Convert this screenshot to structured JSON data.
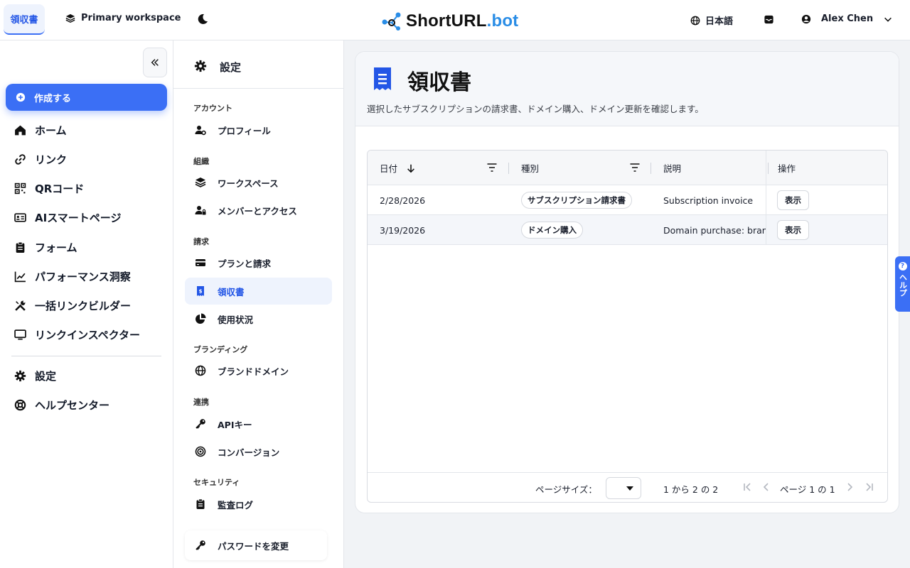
{
  "topbar": {
    "active_tab": "領収書",
    "workspace": "Primary workspace",
    "logo_main": "ShortURL",
    "logo_tld": ".bot",
    "language": "日本語",
    "user_name": "Alex Chen"
  },
  "sidebar": {
    "create_label": "作成する",
    "items": [
      {
        "label": "ホーム",
        "icon": "home-icon"
      },
      {
        "label": "リンク",
        "icon": "link-icon"
      },
      {
        "label": "QRコード",
        "icon": "qr-icon"
      },
      {
        "label": "AIスマートページ",
        "icon": "id-card-icon"
      },
      {
        "label": "フォーム",
        "icon": "clipboard-icon"
      },
      {
        "label": "パフォーマンス洞察",
        "icon": "chart-icon"
      },
      {
        "label": "一括リンクビルダー",
        "icon": "tools-icon"
      },
      {
        "label": "リンクインスペクター",
        "icon": "monitor-icon"
      }
    ],
    "bottom_items": [
      {
        "label": "設定",
        "icon": "gear-icon"
      },
      {
        "label": "ヘルプセンター",
        "icon": "lifebuoy-icon"
      }
    ]
  },
  "settings": {
    "title": "設定",
    "sections": {
      "account": "アカウント",
      "org": "組織",
      "billing": "請求",
      "branding": "ブランディング",
      "integration": "連携",
      "security": "セキュリティ"
    },
    "items": {
      "profile": "プロフィール",
      "workspace": "ワークスペース",
      "members": "メンバーとアクセス",
      "plans": "プランと請求",
      "receipts": "領収書",
      "usage": "使用状況",
      "brand_domains": "ブランドドメイン",
      "api_keys": "APIキー",
      "conversion": "コンバージョン",
      "audit_log": "監査ログ"
    },
    "change_password": "パスワードを変更"
  },
  "main": {
    "title": "領収書",
    "description": "選択したサブスクリプションの請求書、ドメイン購入、ドメイン更新を確認します。",
    "columns": {
      "date": "日付",
      "type": "種別",
      "description": "説明",
      "actions": "操作"
    },
    "rows": [
      {
        "date": "2/28/2026",
        "type": "サブスクリプション請求書",
        "description": "Subscription invoice",
        "action": "表示"
      },
      {
        "date": "3/19/2026",
        "type": "ドメイン購入",
        "description": "Domain purchase: bran",
        "action": "表示"
      }
    ],
    "pagination": {
      "page_size_label": "ページサイズ：",
      "range": "1 から 2 の 2",
      "page": "ページ 1 の 1"
    }
  },
  "help_tab": "ヘルプ",
  "colors": {
    "accent": "#3b6ff5",
    "active_text": "#2356e6",
    "logo_tld": "#2a8de6"
  }
}
